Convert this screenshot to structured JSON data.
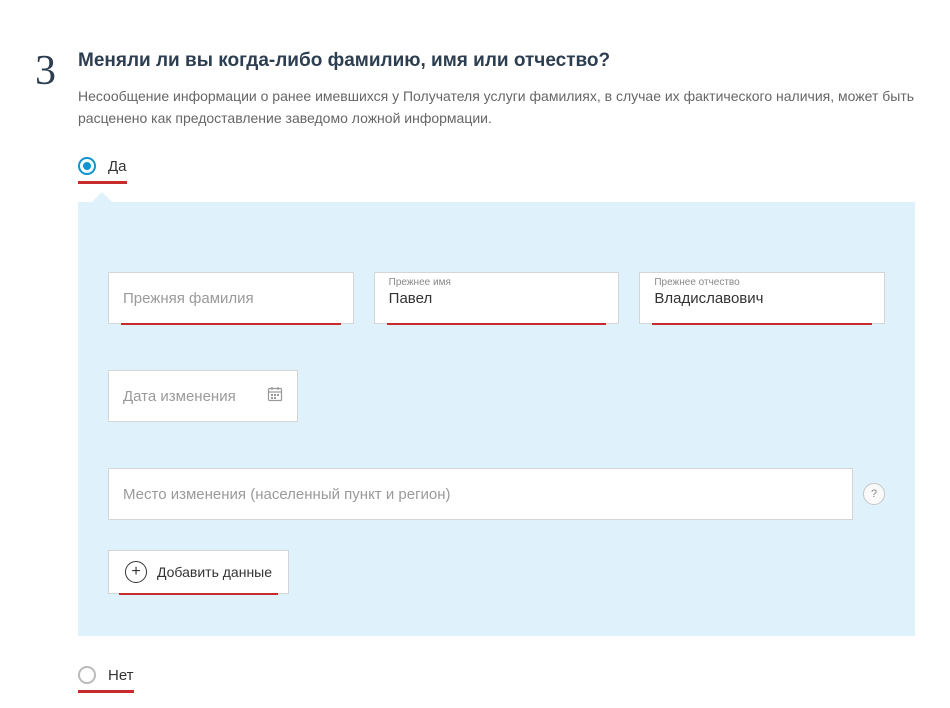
{
  "step_number": "3",
  "heading": "Меняли ли вы когда-либо фамилию, имя или отчество?",
  "subtext": "Несообщение информации о ранее имевшихся у Получателя услуги фамилиях, в случае их фактического наличия, может быть расценено как предоставление заведомо ложной информации.",
  "radio_yes": "Да",
  "radio_no": "Нет",
  "fields": {
    "surname": {
      "placeholder": "Прежняя фамилия",
      "value": ""
    },
    "name": {
      "label": "Прежнее имя",
      "value": "Павел"
    },
    "patronymic": {
      "label": "Прежнее отчество",
      "value": "Владиславович"
    },
    "date": {
      "placeholder": "Дата изменения",
      "value": ""
    },
    "place": {
      "placeholder": "Место изменения (населенный пункт и регион)",
      "value": ""
    }
  },
  "add_button": "Добавить данные",
  "help_symbol": "?"
}
